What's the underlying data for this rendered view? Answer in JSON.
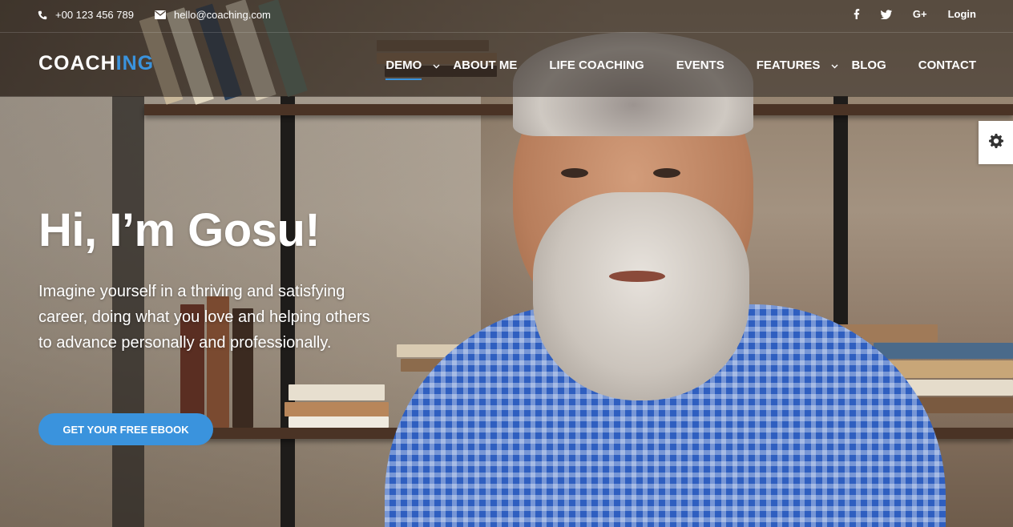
{
  "topbar": {
    "phone": "+00 123 456 789",
    "email": "hello@coaching.com",
    "login_label": "Login",
    "social_icons": [
      "facebook-icon",
      "twitter-icon",
      "google-plus-icon"
    ],
    "google_plus_label": "G+"
  },
  "brand": {
    "logo_main": "COACH",
    "logo_accent": "ING",
    "accent_color": "#3a93dd"
  },
  "nav": {
    "items": [
      {
        "label": "DEMO",
        "has_dropdown": true,
        "active": true
      },
      {
        "label": "ABOUT ME",
        "has_dropdown": false
      },
      {
        "label": "LIFE COACHING",
        "has_dropdown": false
      },
      {
        "label": "EVENTS",
        "has_dropdown": false
      },
      {
        "label": "FEATURES",
        "has_dropdown": true
      },
      {
        "label": "BLOG",
        "has_dropdown": false
      },
      {
        "label": "CONTACT",
        "has_dropdown": false
      }
    ]
  },
  "hero": {
    "title": "Hi, I’m Gosu!",
    "subtitle": "Imagine yourself in a thriving and satisfying career, doing what you love and helping others to advance personally and professionally.",
    "cta_label": "GET YOUR FREE EBOOK"
  },
  "settings": {
    "icon": "gear-icon"
  }
}
